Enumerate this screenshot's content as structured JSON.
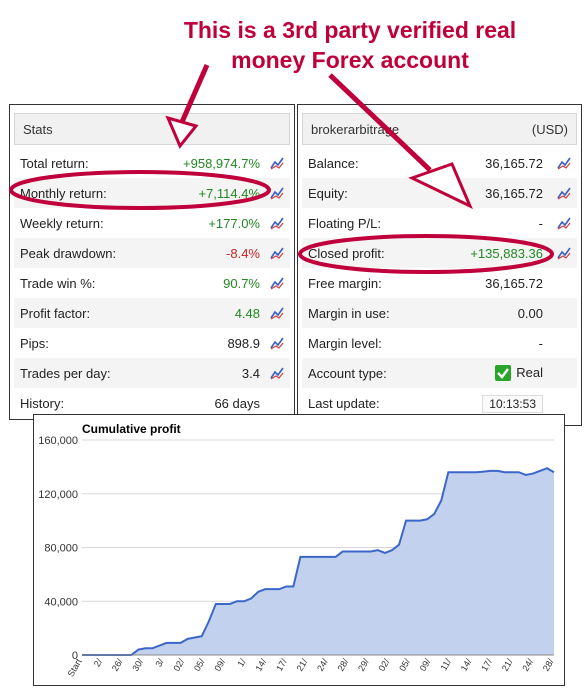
{
  "annotation": {
    "line1": "This is a 3rd party verified real",
    "line2": "money Forex account",
    "color": "#c0003a"
  },
  "stats": {
    "title": "Stats",
    "rows": [
      {
        "label": "Total return:",
        "value": "+958,974.7%",
        "tone": "pos"
      },
      {
        "label": "Monthly return:",
        "value": "+7,114.4%",
        "tone": "pos"
      },
      {
        "label": "Weekly return:",
        "value": "+177.0%",
        "tone": "pos"
      },
      {
        "label": "Peak drawdown:",
        "value": "-8.4%",
        "tone": "neg"
      },
      {
        "label": "Trade win %:",
        "value": "90.7%",
        "tone": "pos"
      },
      {
        "label": "Profit factor:",
        "value": "4.48",
        "tone": "pos"
      },
      {
        "label": "Pips:",
        "value": "898.9",
        "tone": ""
      },
      {
        "label": "Trades per day:",
        "value": "3.4",
        "tone": ""
      },
      {
        "label": "History:",
        "value": "66 days",
        "tone": ""
      }
    ]
  },
  "account": {
    "title": "brokerarbitrage",
    "currency": "(USD)",
    "rows": [
      {
        "label": "Balance:",
        "value": "36,165.72",
        "tone": ""
      },
      {
        "label": "Equity:",
        "value": "36,165.72",
        "tone": ""
      },
      {
        "label": "Floating P/L:",
        "value": "-",
        "tone": ""
      },
      {
        "label": "Closed profit:",
        "value": "+135,883.36",
        "tone": "pos"
      },
      {
        "label": "Free margin:",
        "value": "36,165.72",
        "tone": ""
      },
      {
        "label": "Margin in use:",
        "value": "0.00",
        "tone": ""
      },
      {
        "label": "Margin level:",
        "value": "-",
        "tone": ""
      },
      {
        "label": "Account type:",
        "value": "Real",
        "tone": ""
      },
      {
        "label": "Last update:",
        "value": "10:13:53",
        "tone": ""
      }
    ]
  },
  "chart_data": {
    "type": "area",
    "title": "Cumulative profit",
    "ylim": [
      0,
      160000
    ],
    "yticks": [
      "0",
      "40,000",
      "80,000",
      "120,000",
      "160,000"
    ],
    "xtick_labels": [
      "Start",
      "2/",
      "26/",
      "30/",
      "3/",
      "02/",
      "05/",
      "09/",
      "1/",
      "14/",
      "17/",
      "21/",
      "24/",
      "28/",
      "29/",
      "02/",
      "05/",
      "09/",
      "11/",
      "14/",
      "17/",
      "21/",
      "24/",
      "28/"
    ],
    "series": [
      {
        "values": [
          0,
          0,
          0,
          0,
          0,
          0,
          0,
          0,
          4000,
          5000,
          5000,
          7000,
          9000,
          9000,
          9000,
          12000,
          13000,
          14000,
          25000,
          38000,
          38000,
          38000,
          40000,
          40000,
          42000,
          47000,
          49000,
          49000,
          49000,
          51000,
          51000,
          73000,
          73000,
          73000,
          73000,
          73000,
          73000,
          77000,
          77000,
          77000,
          77000,
          77000,
          78000,
          76000,
          78000,
          82000,
          100000,
          100000,
          100000,
          101000,
          105000,
          115000,
          136000,
          136000,
          136000,
          136000,
          136000,
          136500,
          137000,
          137000,
          136000,
          136000,
          136000,
          134000,
          135000,
          137000,
          139000,
          136000
        ]
      }
    ],
    "grid": true,
    "colors": {
      "line": "#3b67c8",
      "fill": "#c2d1ee"
    }
  }
}
